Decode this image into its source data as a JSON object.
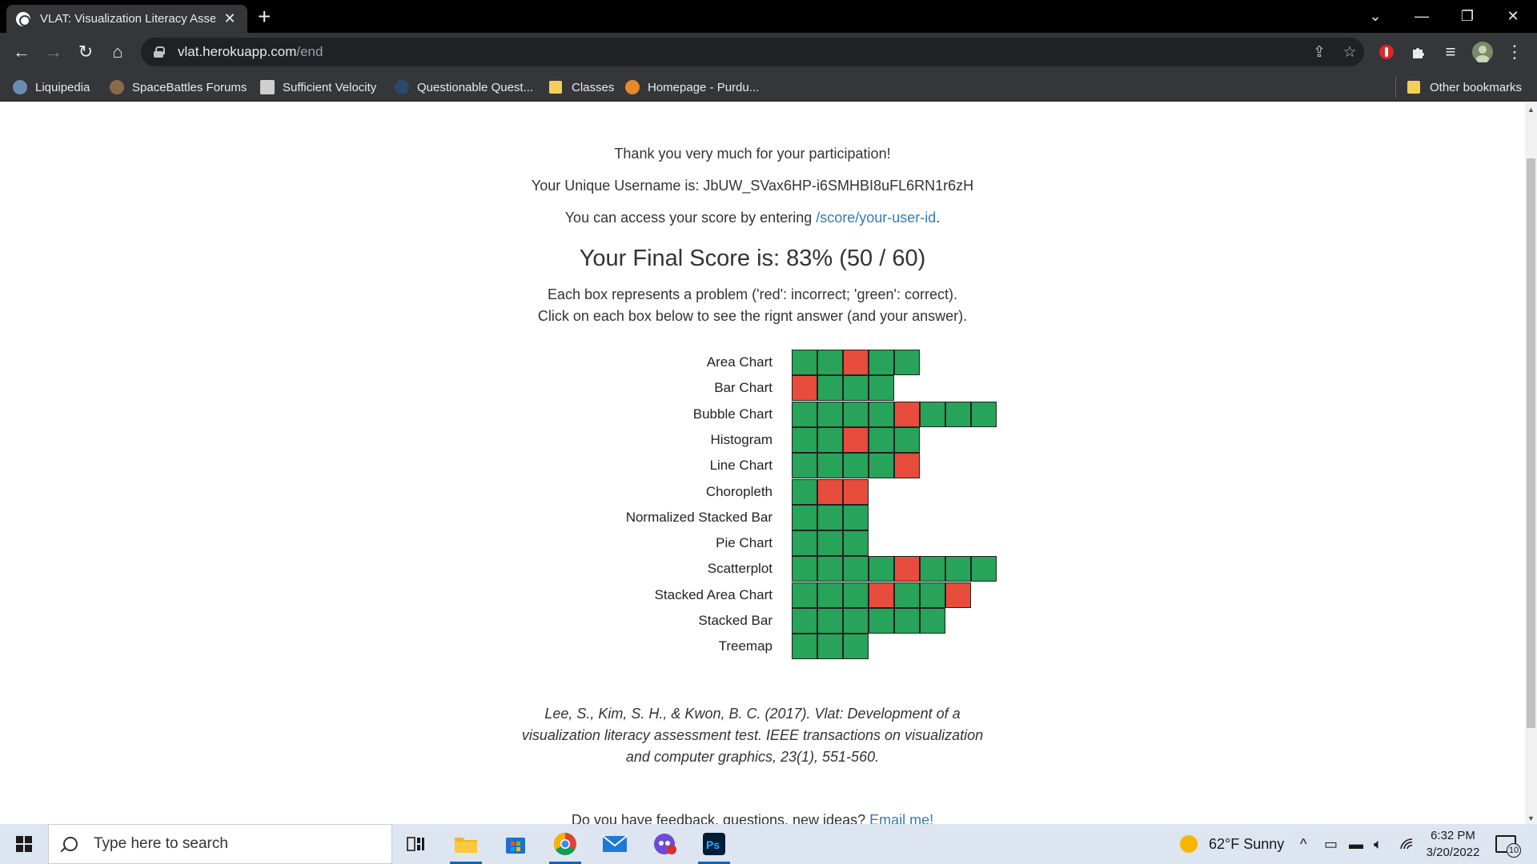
{
  "browser": {
    "tab_title": "VLAT: Visualization Literacy Asse",
    "tab_close": "✕",
    "new_tab": "+",
    "url_host": "vlat.herokuapp.com",
    "url_path": "/end",
    "bookmarks": [
      {
        "label": "Liquipedia"
      },
      {
        "label": "SpaceBattles Forums"
      },
      {
        "label": "Sufficient Velocity"
      },
      {
        "label": "Questionable Quest..."
      },
      {
        "label": "Classes"
      },
      {
        "label": "Homepage - Purdu..."
      }
    ],
    "other_bookmarks": "Other bookmarks"
  },
  "page": {
    "thanks": "Thank you very much for your participation!",
    "username_text": "Your Unique Username is: JbUW_SVax6HP-i6SMHBI8uFL6RN1r6zH",
    "access_prefix": "You can access your score by entering ",
    "access_link": "/score/your-user-id",
    "access_suffix": ".",
    "final_score": "Your Final Score is: 83% (50 / 60)",
    "explain_1": "Each box represents a problem ('red': incorrect; 'green': correct).",
    "explain_2": "Click on each box below to see the rignt answer (and your answer).",
    "citation_1": "Lee, S., Kim, S. H., & Kwon, B. C. (2017). Vlat: Development of a",
    "citation_2": "visualization literacy assessment test. IEEE transactions on visualization",
    "citation_3": "and computer graphics, 23(1), 551-560.",
    "feedback_prefix": "Do you have feedback, questions, new ideas? ",
    "feedback_link": "Email me!"
  },
  "colors": {
    "correct": "#27a35a",
    "incorrect": "#e74c3c",
    "link": "#337ab7"
  },
  "results": [
    {
      "label": "Area Chart",
      "cells": [
        "correct",
        "correct",
        "incorrect",
        "correct",
        "correct"
      ]
    },
    {
      "label": "Bar Chart",
      "cells": [
        "incorrect",
        "correct",
        "correct",
        "correct"
      ]
    },
    {
      "label": "Bubble Chart",
      "cells": [
        "correct",
        "correct",
        "correct",
        "correct",
        "incorrect",
        "correct",
        "correct",
        "correct"
      ]
    },
    {
      "label": "Histogram",
      "cells": [
        "correct",
        "correct",
        "incorrect",
        "correct",
        "correct"
      ]
    },
    {
      "label": "Line Chart",
      "cells": [
        "correct",
        "correct",
        "correct",
        "correct",
        "incorrect"
      ]
    },
    {
      "label": "Choropleth",
      "cells": [
        "correct",
        "incorrect",
        "incorrect"
      ]
    },
    {
      "label": "Normalized Stacked Bar",
      "cells": [
        "correct",
        "correct",
        "correct"
      ]
    },
    {
      "label": "Pie Chart",
      "cells": [
        "correct",
        "correct",
        "correct"
      ]
    },
    {
      "label": "Scatterplot",
      "cells": [
        "correct",
        "correct",
        "correct",
        "correct",
        "incorrect",
        "correct",
        "correct",
        "correct"
      ]
    },
    {
      "label": "Stacked Area Chart",
      "cells": [
        "correct",
        "correct",
        "correct",
        "incorrect",
        "correct",
        "correct",
        "incorrect"
      ]
    },
    {
      "label": "Stacked Bar",
      "cells": [
        "correct",
        "correct",
        "correct",
        "correct",
        "correct",
        "correct"
      ]
    },
    {
      "label": "Treemap",
      "cells": [
        "correct",
        "correct",
        "correct"
      ]
    }
  ],
  "taskbar": {
    "search_placeholder": "Type here to search",
    "weather": "62°F  Sunny",
    "time": "6:32 PM",
    "date": "3/20/2022",
    "notification_count": "10"
  }
}
